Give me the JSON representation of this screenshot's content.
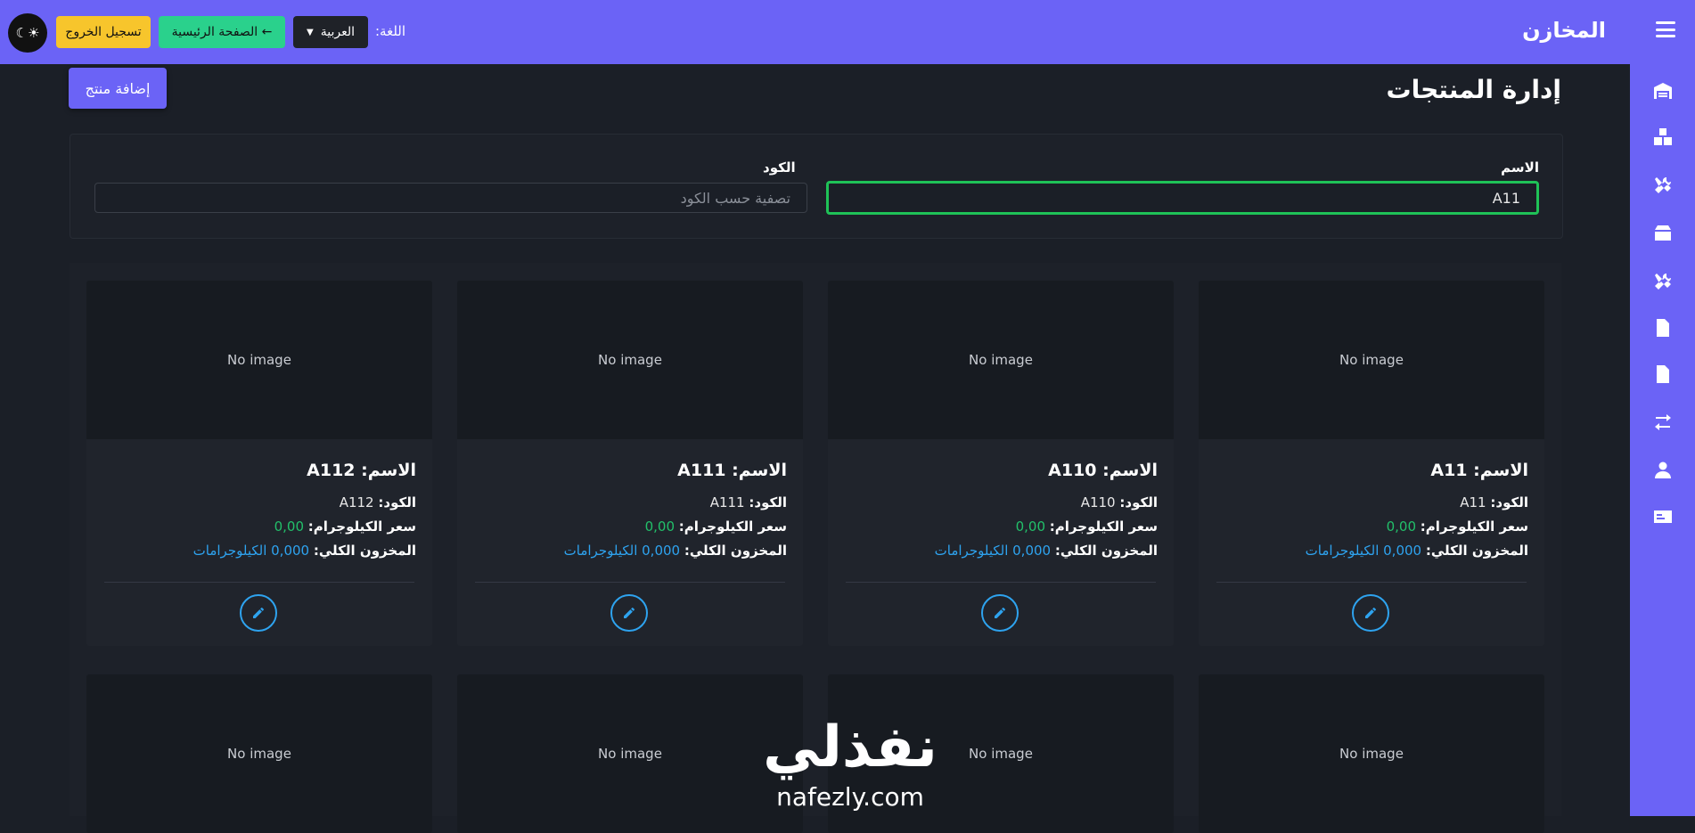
{
  "topbar": {
    "brand": "المخازن",
    "language_label": "اللغة:",
    "language_value": "العربية",
    "home_label": "← الصفحة الرئيسية",
    "logout_label": "تسجيل الخروج",
    "theme_icon": "☾☀"
  },
  "sidebar": {
    "icons": [
      "warehouse-icon",
      "boxes-icon",
      "tools-icon",
      "box-icon",
      "tools-alt-icon",
      "document-icon",
      "invoice-icon",
      "transfer-icon",
      "user-icon",
      "id-card-icon"
    ]
  },
  "page": {
    "title": "إدارة المنتجات",
    "add_button": "إضافة منتج"
  },
  "filters": {
    "name_label": "الاسم",
    "name_value": "A11",
    "code_label": "الكود",
    "code_placeholder": "تصفية حسب الكود"
  },
  "products": [
    {
      "image_text": "No image",
      "name_label": "الاسم:",
      "name": "A11",
      "code_label": "الكود:",
      "code": "A11",
      "price_label": "سعر الكيلوجرام:",
      "price": "0,00",
      "stock_label": "المخزون الكلي:",
      "stock": "0,000 الكيلوجرامات"
    },
    {
      "image_text": "No image",
      "name_label": "الاسم:",
      "name": "A110",
      "code_label": "الكود:",
      "code": "A110",
      "price_label": "سعر الكيلوجرام:",
      "price": "0,00",
      "stock_label": "المخزون الكلي:",
      "stock": "0,000 الكيلوجرامات"
    },
    {
      "image_text": "No image",
      "name_label": "الاسم:",
      "name": "A111",
      "code_label": "الكود:",
      "code": "A111",
      "price_label": "سعر الكيلوجرام:",
      "price": "0,00",
      "stock_label": "المخزون الكلي:",
      "stock": "0,000 الكيلوجرامات"
    },
    {
      "image_text": "No image",
      "name_label": "الاسم:",
      "name": "A112",
      "code_label": "الكود:",
      "code": "A112",
      "price_label": "سعر الكيلوجرام:",
      "price": "0,00",
      "stock_label": "المخزون الكلي:",
      "stock": "0,000 الكيلوجرامات"
    }
  ],
  "second_row": [
    {
      "image_text": "No image"
    },
    {
      "image_text": "No image"
    },
    {
      "image_text": "No image"
    },
    {
      "image_text": "No image"
    }
  ],
  "watermark": {
    "arabic": "نفذلي",
    "latin": "nafezly.com"
  }
}
